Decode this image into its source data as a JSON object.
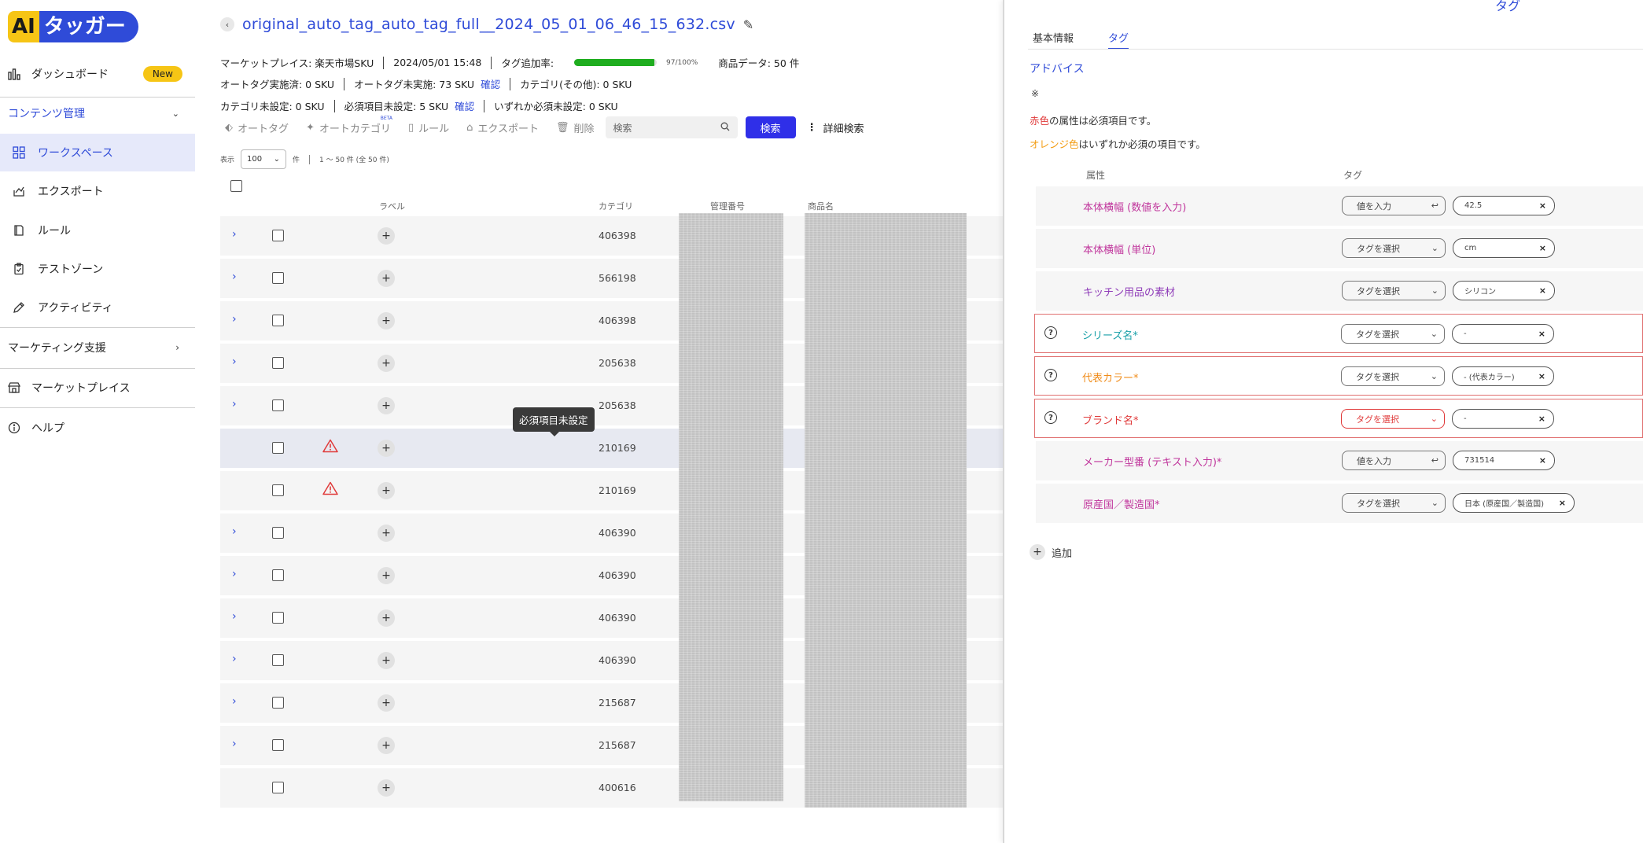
{
  "app": {
    "logo_ai": "AI",
    "logo_name": "タッガー"
  },
  "sidebar": {
    "dashboard": "ダッシュボード",
    "new_badge": "New",
    "content_section": "コンテンツ管理",
    "items": [
      "ワークスペース",
      "エクスポート",
      "ルール",
      "テストゾーン",
      "アクティビティ"
    ],
    "marketing_section": "マーケティング支援",
    "marketplace": "マーケットプレイス",
    "help": "ヘルプ"
  },
  "file": {
    "name": "original_auto_tag_auto_tag_full__2024_05_01_06_46_15_632.csv"
  },
  "meta": {
    "marketplace": "マーケットプレイス: 楽天市場SKU",
    "datetime": "2024/05/01 15:48",
    "tag_rate_label": "タグ追加率:",
    "tag_rate_pct": 97,
    "tag_rate_text": "97/100%",
    "product_data": "商品データ: 50 件",
    "auto_done": "オートタグ実施済: 0 SKU",
    "auto_not_done": "オートタグ未実施: 73 SKU",
    "confirm": "確認",
    "category_other": "カテゴリ(その他): 0 SKU",
    "category_unset": "カテゴリ未設定: 0 SKU",
    "required_unset": "必須項目未設定: 5 SKU",
    "either_required_unset": "いずれか必須未設定: 0 SKU"
  },
  "toolbar": {
    "auto_tag": "オートタグ",
    "auto_category": "オートカテゴリ",
    "beta": "BETA",
    "rule": "ルール",
    "export": "エクスポート",
    "delete": "削除",
    "search_placeholder": "検索",
    "search_button": "検索",
    "detail_search": "詳細検索"
  },
  "paging": {
    "show_label": "表示",
    "per_page": "100",
    "unit": "件",
    "range": "1 ～ 50 件 (全 50 件)"
  },
  "table": {
    "headers": {
      "label": "ラベル",
      "category": "カテゴリ",
      "manage_no": "管理番号",
      "product_name": "商品名"
    },
    "rows": [
      {
        "category": "406398",
        "expand": true,
        "warn": false
      },
      {
        "category": "566198",
        "expand": true,
        "warn": false
      },
      {
        "category": "406398",
        "expand": true,
        "warn": false
      },
      {
        "category": "205638",
        "expand": true,
        "warn": false
      },
      {
        "category": "205638",
        "expand": true,
        "warn": false
      },
      {
        "category": "210169",
        "expand": false,
        "warn": true
      },
      {
        "category": "210169",
        "expand": false,
        "warn": true
      },
      {
        "category": "406390",
        "expand": true,
        "warn": false
      },
      {
        "category": "406390",
        "expand": true,
        "warn": false
      },
      {
        "category": "406390",
        "expand": true,
        "warn": false
      },
      {
        "category": "406390",
        "expand": true,
        "warn": false
      },
      {
        "category": "215687",
        "expand": true,
        "warn": false
      },
      {
        "category": "215687",
        "expand": true,
        "warn": false
      },
      {
        "category": "400616",
        "expand": false,
        "warn": false
      }
    ],
    "tooltip": "必須項目未設定"
  },
  "panel": {
    "title": "タグ",
    "tabs": [
      "基本情報",
      "タグ"
    ],
    "advice_title": "アドバイス",
    "note_mark": "※",
    "legend_red_word": "赤色",
    "legend_red_rest": "の属性は必須項目です。",
    "legend_orange_word": "オレンジ色",
    "legend_orange_rest": "はいずれか必須の項目です。",
    "col_attr": "属性",
    "col_tag": "タグ",
    "add": "追加",
    "attributes": [
      {
        "name": "本体横幅 (数値を入力)",
        "color": "#c0359c",
        "input": "値を入力",
        "input_type": "text",
        "value": "42.5",
        "required": false
      },
      {
        "name": "本体横幅 (単位)",
        "color": "#c0359c",
        "input": "タグを選択",
        "input_type": "select",
        "value": "cm",
        "required": false
      },
      {
        "name": "キッチン用品の素材",
        "color": "#8e3bb8",
        "input": "タグを選択",
        "input_type": "select",
        "value": "シリコン",
        "required": false
      },
      {
        "name": "シリーズ名*",
        "color": "#1aa0a8",
        "input": "タグを選択",
        "input_type": "select",
        "value": "-",
        "required": true,
        "error": false
      },
      {
        "name": "代表カラー*",
        "color": "#f08c1a",
        "input": "タグを選択",
        "input_type": "select",
        "value": "- (代表カラー)",
        "required": true,
        "error": false
      },
      {
        "name": "ブランド名*",
        "color": "#e03a3a",
        "input": "タグを選択",
        "input_type": "select",
        "value": "-",
        "required": true,
        "error": true
      },
      {
        "name": "メーカー型番 (テキスト入力)*",
        "color": "#c0359c",
        "input": "値を入力",
        "input_type": "text",
        "value": "731514",
        "required": false
      },
      {
        "name": "原産国／製造国*",
        "color": "#c0359c",
        "input": "タグを選択",
        "input_type": "select",
        "value": "日本 (原産国／製造国)",
        "required": false,
        "wide": true
      }
    ]
  },
  "colors": {
    "accent": "#2f4bd8",
    "progress": "#1fad1f",
    "search_button": "#2f2fe8",
    "warn": "#e03a3a",
    "logo_yellow": "#f6c515"
  }
}
